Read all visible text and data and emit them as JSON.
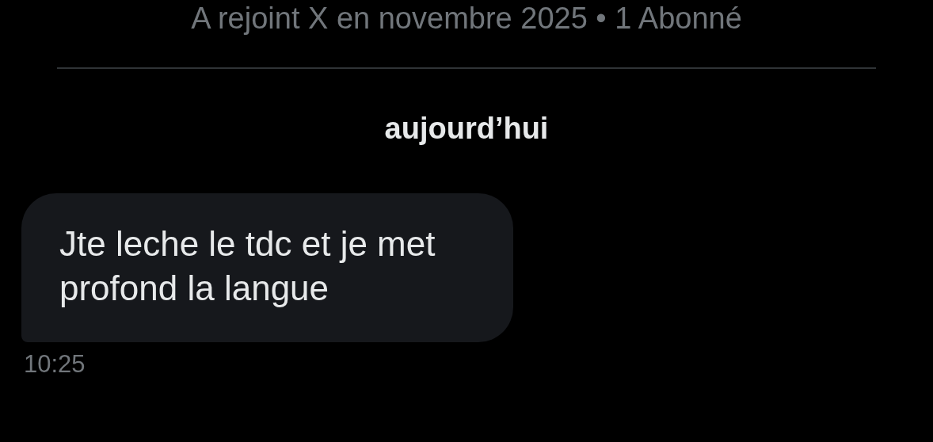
{
  "profile": {
    "joined": "A rejoint X en novembre 2025 • 1 Abonné"
  },
  "conversation": {
    "date_separator": "aujourd’hui",
    "messages": [
      {
        "text": "Jte leche le tdc et je met profond la langue",
        "time": "10:25"
      }
    ]
  }
}
